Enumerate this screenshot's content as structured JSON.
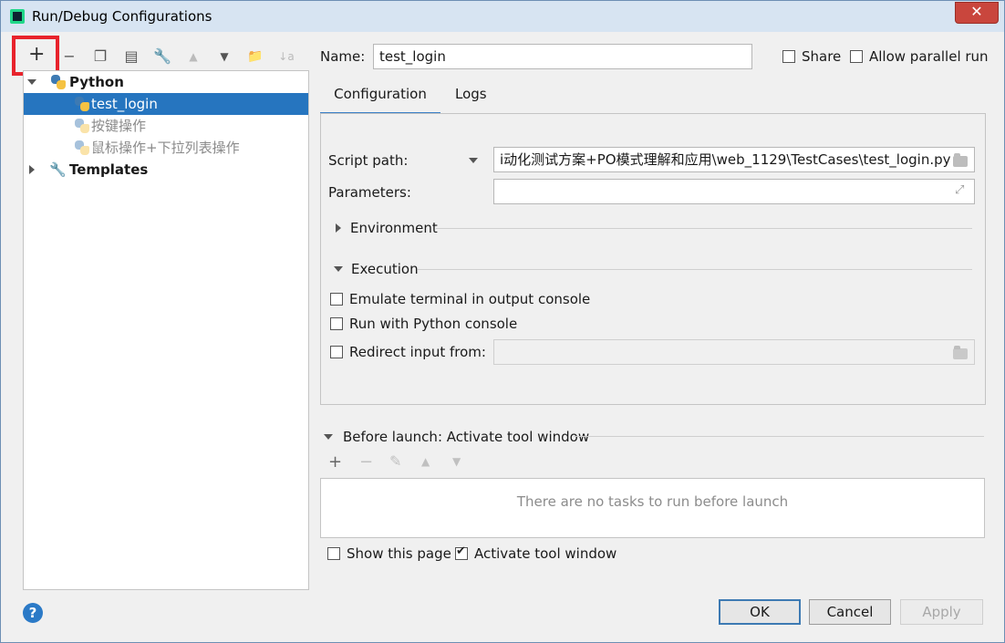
{
  "window": {
    "title": "Run/Debug Configurations",
    "close": "✕"
  },
  "toolbar": {
    "add": "+",
    "remove": "−",
    "copy": "❐",
    "save": "▤",
    "edit_defaults": "🔧",
    "move_up": "▲",
    "move_down": "▼",
    "new_folder": "📁",
    "sort": "↓a"
  },
  "tree": {
    "python": {
      "label": "Python"
    },
    "items": [
      {
        "label": "test_login",
        "selected": true
      },
      {
        "label": "按键操作",
        "selected": false
      },
      {
        "label": "鼠标操作+下拉列表操作",
        "selected": false
      }
    ],
    "templates": {
      "label": "Templates"
    }
  },
  "name_field": {
    "label": "Name:",
    "value": "test_login"
  },
  "share": {
    "label": "Share",
    "checked": false
  },
  "allow_parallel": {
    "label": "Allow parallel run",
    "checked": false
  },
  "tabs": [
    {
      "label": "Configuration",
      "active": true
    },
    {
      "label": "Logs",
      "active": false
    }
  ],
  "config": {
    "script_path_label": "Script path:",
    "script_path_value": "i动化测试方案+PO模式理解和应用\\web_1129\\TestCases\\test_login.py",
    "parameters_label": "Parameters:",
    "parameters_value": "",
    "environment_label": "Environment",
    "execution_label": "Execution",
    "emulate_terminal": {
      "label": "Emulate terminal in output console",
      "checked": false
    },
    "run_python_console": {
      "label": "Run with Python console",
      "checked": false
    },
    "redirect_input": {
      "label": "Redirect input from:",
      "checked": false,
      "value": ""
    }
  },
  "before_launch": {
    "label": "Before launch: Activate tool window",
    "empty_text": "There are no tasks to run before launch",
    "toolbar": {
      "add": "+",
      "remove": "−",
      "edit": "✎",
      "up": "▲",
      "down": "▼"
    }
  },
  "show_this_page": {
    "label": "Show this page",
    "checked": false
  },
  "activate_tool_window": {
    "label": "Activate tool window",
    "checked": true
  },
  "buttons": {
    "help": "?",
    "ok": "OK",
    "cancel": "Cancel",
    "apply": "Apply"
  }
}
